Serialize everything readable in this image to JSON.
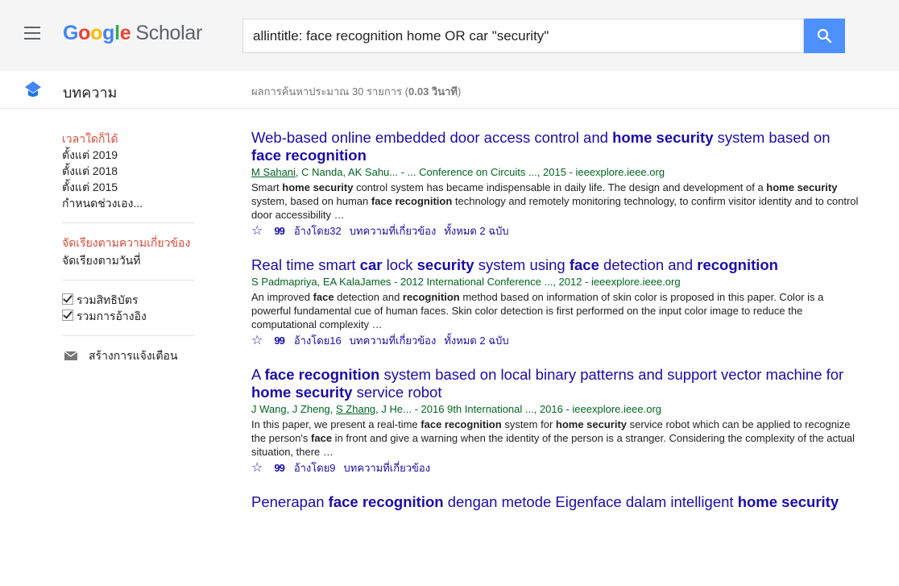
{
  "header": {
    "logo_google": "Google",
    "logo_scholar": "Scholar",
    "search_value": "allintitle: face recognition home OR car \"security\""
  },
  "subheader": {
    "section_label": "บทความ",
    "stats_prefix": "ผลการค้นหาประมาณ 30 รายการ (",
    "stats_time": "0.03 วินาที",
    "stats_suffix": ")"
  },
  "sidebar": {
    "time_items": [
      "เวลาใดก็ได้",
      "ตั้งแต่ 2019",
      "ตั้งแต่ 2018",
      "ตั้งแต่ 2015",
      "กำหนดช่วงเอง..."
    ],
    "sort_relevance": "จัดเรียงตามความเกี่ยวข้อง",
    "sort_date": "จัดเรียงตามวันที่",
    "include_patents": "รวมสิทธิบัตร",
    "include_citations": "รวมการอ้างอิง",
    "create_alert": "สร้างการแจ้งเตือน"
  },
  "results": [
    {
      "title": [
        [
          "Web-based online embedded door access control and ",
          false
        ],
        [
          "home security",
          true
        ],
        [
          " system based on ",
          false
        ],
        [
          "face recognition",
          true
        ]
      ],
      "authors": [
        [
          "M Sahani",
          true
        ],
        [
          ", C Nanda, AK Sahu... - ... Conference on Circuits ..., 2015 - ieeexplore.ieee.org",
          false
        ]
      ],
      "snippet": [
        [
          "Smart ",
          false
        ],
        [
          "home security",
          true
        ],
        [
          " control system has became indispensable in daily life. The design and development of a ",
          false
        ],
        [
          "home security",
          true
        ],
        [
          " system, based on human ",
          false
        ],
        [
          "face recognition",
          true
        ],
        [
          " technology and remotely monitoring technology, to confirm visitor identity and to control door accessibility …",
          false
        ]
      ],
      "cited_by": "อ้างโดย32",
      "related": "บทความที่เกี่ยวข้อง",
      "versions": "ทั้งหมด 2 ฉบับ"
    },
    {
      "title": [
        [
          "Real time smart ",
          false
        ],
        [
          "car",
          true
        ],
        [
          " lock ",
          false
        ],
        [
          "security",
          true
        ],
        [
          " system using ",
          false
        ],
        [
          "face",
          true
        ],
        [
          " detection and ",
          false
        ],
        [
          "recognition",
          true
        ]
      ],
      "authors": [
        [
          "S Padmapriya, EA KalaJames - 2012 International Conference ..., 2012 - ieeexplore.ieee.org",
          false
        ]
      ],
      "snippet": [
        [
          "An improved ",
          false
        ],
        [
          "face",
          true
        ],
        [
          " detection and ",
          false
        ],
        [
          "recognition",
          true
        ],
        [
          " method based on information of skin color is proposed in this paper. Color is a powerful fundamental cue of human faces. Skin color detection is first performed on the input color image to reduce the computational complexity …",
          false
        ]
      ],
      "cited_by": "อ้างโดย16",
      "related": "บทความที่เกี่ยวข้อง",
      "versions": "ทั้งหมด 2 ฉบับ"
    },
    {
      "title": [
        [
          "A ",
          false
        ],
        [
          "face recognition",
          true
        ],
        [
          " system based on local binary patterns and support vector machine for ",
          false
        ],
        [
          "home security",
          true
        ],
        [
          " service robot",
          false
        ]
      ],
      "authors": [
        [
          "J Wang, J Zheng, ",
          false
        ],
        [
          "S Zhang",
          true
        ],
        [
          ", J He... - 2016 9th International ..., 2016 - ieeexplore.ieee.org",
          false
        ]
      ],
      "snippet": [
        [
          "In this paper, we present a real-time ",
          false
        ],
        [
          "face recognition",
          true
        ],
        [
          " system for ",
          false
        ],
        [
          "home security",
          true
        ],
        [
          " service robot which can be applied to recognize the person's ",
          false
        ],
        [
          "face",
          true
        ],
        [
          " in front and give a warning when the identity of the person is a stranger. Considering the complexity of the actual situation, there …",
          false
        ]
      ],
      "cited_by": "อ้างโดย9",
      "related": "บทความที่เกี่ยวข้อง",
      "versions": ""
    },
    {
      "title": [
        [
          "Penerapan ",
          false
        ],
        [
          "face recognition",
          true
        ],
        [
          " dengan metode Eigenface dalam intelligent ",
          false
        ],
        [
          "home security",
          true
        ]
      ],
      "authors": [],
      "snippet": [],
      "cited_by": "",
      "related": "",
      "versions": ""
    }
  ],
  "icons": {
    "star": "☆",
    "cite": "99"
  },
  "colors": {
    "link": "#1a0dab",
    "author": "#006621",
    "active": "#dd4b39",
    "search_button": "#4d90fe"
  }
}
